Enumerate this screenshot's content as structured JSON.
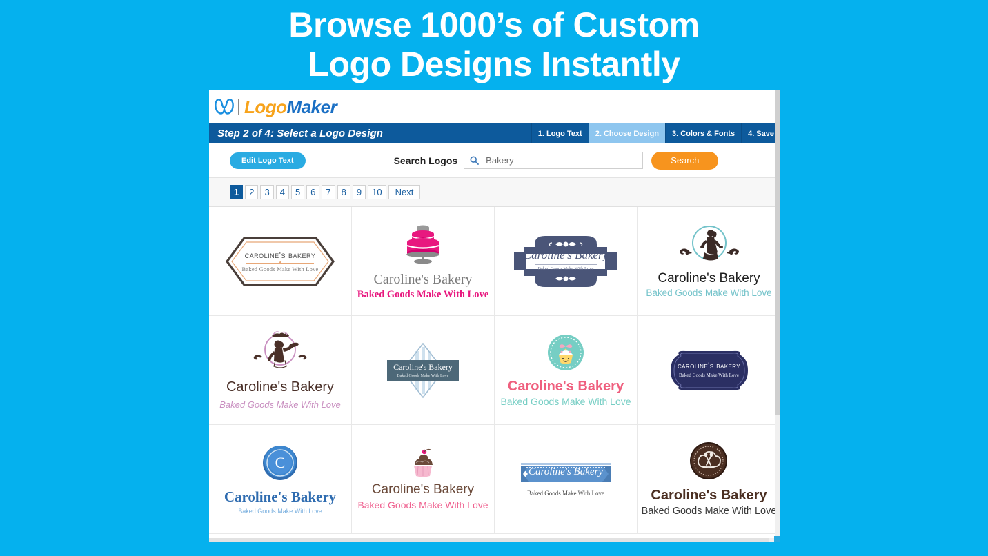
{
  "promo": {
    "line1": "Browse 1000’s of Custom",
    "line2": "Logo Designs Instantly"
  },
  "brand": {
    "mark": "w-logo-icon",
    "logo_word": "Logo",
    "maker_word": "Maker"
  },
  "stepbar": {
    "title": "Step 2 of 4: Select a Logo Design",
    "steps": [
      {
        "label": "1. Logo Text",
        "active": false
      },
      {
        "label": "2. Choose Design",
        "active": true
      },
      {
        "label": "3. Colors & Fonts",
        "active": false
      },
      {
        "label": "4. Save",
        "active": false
      }
    ]
  },
  "toolbar": {
    "edit_logo_text": "Edit Logo Text",
    "search_label": "Search Logos",
    "search_value": "Bakery",
    "search_placeholder": "Bakery",
    "search_button": "Search",
    "search_icon": "magnifier-icon"
  },
  "pagination": {
    "pages": [
      "1",
      "2",
      "3",
      "4",
      "5",
      "6",
      "7",
      "8",
      "9",
      "10"
    ],
    "active_page": "1",
    "next_label": "Next"
  },
  "logos": [
    {
      "id": "hexagon-badge",
      "name": "Caroline's Bakery",
      "tagline": "Baked Goods Make With Love",
      "colors": {
        "frame": "#4a3f3a",
        "accent": "#e8a878",
        "text": "#4a4a4a"
      }
    },
    {
      "id": "pink-tiered-cake",
      "name": "Caroline's Bakery",
      "tagline": "Baked Goods Make With Love",
      "colors": {
        "cake": "#e8187f",
        "stand": "#8b8b8b",
        "name": "#7b7b7b"
      }
    },
    {
      "id": "navy-vintage-plaque",
      "name": "Caroline's Bakery",
      "tagline": "Baked Goods Make With Love",
      "colors": {
        "badge": "#4a5578",
        "text": "#4a5578"
      }
    },
    {
      "id": "teal-circle-baker-lady",
      "name": "Caroline's Bakery",
      "tagline": "Baked Goods Make With Love",
      "colors": {
        "circle": "#74c3ca",
        "figure": "#3b2a26",
        "name": "#1d1d1d"
      }
    },
    {
      "id": "pink-circle-baker-lady",
      "name": "Caroline's Bakery",
      "tagline": "Baked Goods Make With Love",
      "colors": {
        "circle": "#c98fc0",
        "figure": "#4a3028",
        "name": "#4a3028"
      }
    },
    {
      "id": "striped-diamond-plate",
      "name": "Caroline's Bakery",
      "tagline": "Baked Goods Make With Love",
      "colors": {
        "plate": "#4d6878",
        "diamond": "#b8cfe0"
      }
    },
    {
      "id": "teal-cupcake-seal",
      "name": "Caroline's Bakery",
      "tagline": "Baked Goods Make With Love",
      "colors": {
        "seal": "#76cec4",
        "name": "#ef5f7e",
        "tagline": "#76cec4"
      }
    },
    {
      "id": "navy-rounded-plaque",
      "name": "Caroline's Bakery",
      "tagline": "Baked Goods Make With Love",
      "colors": {
        "plaque": "#2b2f63",
        "text": "#ffffff"
      }
    },
    {
      "id": "blue-wax-seal-monogram",
      "name": "Caroline's Bakery",
      "tagline": "Baked Goods Make With Love",
      "monogram": "C",
      "colors": {
        "seal": "#3d87cf",
        "name": "#2f6cb0",
        "tagline": "#77aede"
      }
    },
    {
      "id": "brown-cupcake",
      "name": "Caroline's Bakery",
      "tagline": "Baked Goods Make With Love",
      "colors": {
        "frosting": "#6b4a3a",
        "liner": "#f6b9cf",
        "tagline": "#ef5f8e"
      }
    },
    {
      "id": "blue-ribbon-banner",
      "name": "Caroline's Bakery",
      "tagline": "Baked Goods Make With Love",
      "colors": {
        "ribbon": "#5b92cd",
        "text": "#ffffff",
        "tagline": "#4a4a4a"
      }
    },
    {
      "id": "brown-chef-hat-medallion",
      "name": "Caroline's Bakery",
      "tagline": "Baked Goods Make With Love",
      "colors": {
        "medallion": "#4b2f22",
        "name": "#4b2f22",
        "tagline": "#3b3b3b"
      }
    }
  ],
  "theme": {
    "page_background": "#05b1ee",
    "step_bar": "#0d5a9c",
    "active_step": "#8ec6ef",
    "primary_button": "#29abe2",
    "search_button": "#f7941e",
    "brand_orange": "#f7a31b",
    "brand_blue": "#1a6fc4"
  }
}
